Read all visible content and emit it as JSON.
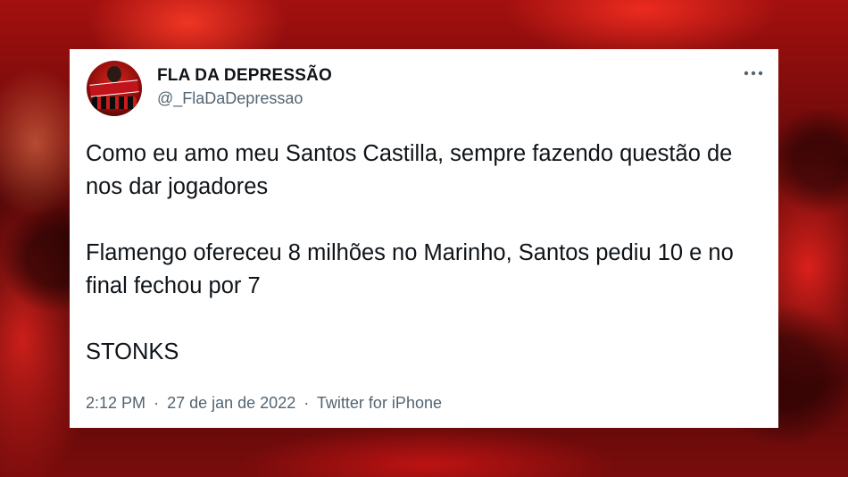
{
  "tweet": {
    "author_name": "FLA DA DEPRESSÃO",
    "author_handle": "@_FlaDaDepressao",
    "paragraphs": [
      "Como eu amo meu Santos Castilla, sempre fazendo questão de nos dar jogadores",
      "Flamengo ofereceu 8 milhões no Marinho, Santos pediu 10 e no final fechou por 7",
      "STONKS"
    ],
    "time": "2:12 PM",
    "separator": "·",
    "date": "27 de jan de 2022",
    "source": "Twitter for iPhone"
  },
  "icons": {
    "more": "more-horizontal-icon",
    "avatar": "profile-avatar"
  },
  "colors": {
    "text_primary": "#0f1419",
    "text_secondary": "#536471",
    "card_background": "#ffffff",
    "background_accent": "#c8141a"
  }
}
